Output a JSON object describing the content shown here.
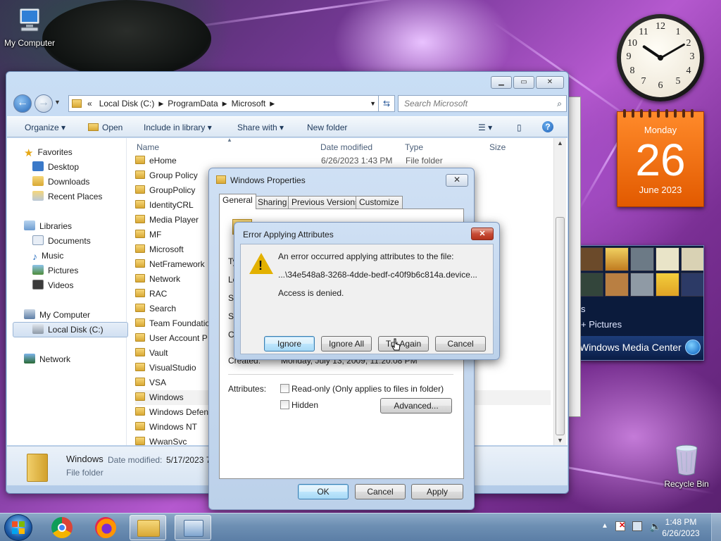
{
  "desktop": {
    "icons": [
      {
        "label": "My Computer"
      },
      {
        "label": "Recycle Bin"
      }
    ]
  },
  "gadgets": {
    "clock": {
      "numbers": [
        "12",
        "1",
        "2",
        "3",
        "4",
        "5",
        "6",
        "7",
        "8",
        "9",
        "10",
        "11"
      ]
    },
    "calendar": {
      "day_of_week": "Monday",
      "day": "26",
      "month_year": "June 2023"
    },
    "media_center": {
      "pictures_label": "+ Pictures",
      "partial_label": "s",
      "title": "Windows Media Center"
    }
  },
  "explorer": {
    "breadcrumb": {
      "prefix": "«",
      "segments": [
        "Local Disk (C:)",
        "ProgramData",
        "Microsoft"
      ]
    },
    "search_placeholder": "Search Microsoft",
    "toolbar": {
      "organize": "Organize",
      "open": "Open",
      "include_in_library": "Include in library",
      "share_with": "Share with",
      "new_folder": "New folder"
    },
    "nav": {
      "favorites": "Favorites",
      "desktop": "Desktop",
      "downloads": "Downloads",
      "recent_places": "Recent Places",
      "libraries": "Libraries",
      "documents": "Documents",
      "music": "Music",
      "pictures": "Pictures",
      "videos": "Videos",
      "my_computer": "My Computer",
      "local_disk": "Local Disk (C:)",
      "network": "Network"
    },
    "columns": {
      "name": "Name",
      "date_modified": "Date modified",
      "type": "Type",
      "size": "Size"
    },
    "files": [
      {
        "name": "eHome",
        "date": "6/26/2023 1:43 PM",
        "type": "File folder"
      },
      {
        "name": "Group Policy",
        "date": "",
        "type": ""
      },
      {
        "name": "GroupPolicy",
        "date": "",
        "type": ""
      },
      {
        "name": "IdentityCRL",
        "date": "",
        "type": ""
      },
      {
        "name": "Media Player",
        "date": "",
        "type": ""
      },
      {
        "name": "MF",
        "date": "",
        "type": ""
      },
      {
        "name": "Microsoft",
        "date": "",
        "type": ""
      },
      {
        "name": "NetFramework",
        "date": "",
        "type": ""
      },
      {
        "name": "Network",
        "date": "",
        "type": ""
      },
      {
        "name": "RAC",
        "date": "",
        "type": ""
      },
      {
        "name": "Search",
        "date": "",
        "type": ""
      },
      {
        "name": "Team Foundatio",
        "date": "",
        "type": ""
      },
      {
        "name": "User Account P",
        "date": "",
        "type": ""
      },
      {
        "name": "Vault",
        "date": "",
        "type": ""
      },
      {
        "name": "VisualStudio",
        "date": "",
        "type": ""
      },
      {
        "name": "VSA",
        "date": "",
        "type": ""
      },
      {
        "name": "Windows",
        "date": "",
        "type": ""
      },
      {
        "name": "Windows Defen",
        "date": "",
        "type": ""
      },
      {
        "name": "Windows NT",
        "date": "",
        "type": ""
      },
      {
        "name": "WwanSvc",
        "date": "",
        "type": ""
      }
    ],
    "details": {
      "name": "Windows",
      "date_label": "Date modified:",
      "date_value": "5/17/2023 7",
      "type": "File folder"
    }
  },
  "properties": {
    "title": "Windows Properties",
    "tabs": [
      "General",
      "Sharing",
      "Previous Versions",
      "Customize"
    ],
    "partial_labels": [
      "Ty",
      "Lo",
      "Si",
      "Si",
      "C"
    ],
    "created_label": "Created:",
    "created_value": "Monday, July 13, 2009, 11:20:08 PM",
    "attributes_label": "Attributes:",
    "readonly_label": "Read-only (Only applies to files in folder)",
    "hidden_label": "Hidden",
    "advanced_button": "Advanced...",
    "ok": "OK",
    "cancel": "Cancel",
    "apply": "Apply"
  },
  "error": {
    "title": "Error Applying Attributes",
    "line1": "An error occurred applying attributes to the file:",
    "line2": "...\\34e548a8-3268-4dde-bedf-c40f9b6c814a.device...",
    "line3": "Access is denied.",
    "ignore": "Ignore",
    "ignore_all": "Ignore All",
    "try_again": "Try Again",
    "cancel": "Cancel",
    "close_glyph": "✕"
  },
  "taskbar": {
    "time": "1:48 PM",
    "date": "6/26/2023"
  }
}
